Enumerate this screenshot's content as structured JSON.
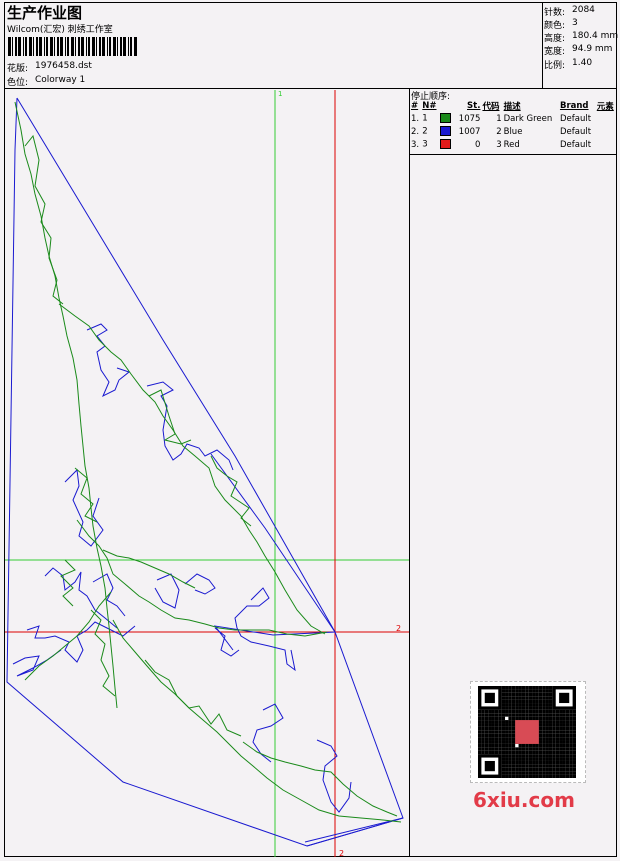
{
  "header": {
    "title": "生产作业图",
    "subtitle": "Wilcom(汇宏) 刺绣工作室",
    "design_label": "花版:",
    "design_value": "1976458.dst",
    "colorway_label": "色位:",
    "colorway_value": "Colorway 1"
  },
  "stats": [
    {
      "label": "针数:",
      "value": "2084"
    },
    {
      "label": "颜色:",
      "value": "3"
    },
    {
      "label": "高度:",
      "value": "180.4 mm"
    },
    {
      "label": "宽度:",
      "value": "94.9 mm"
    },
    {
      "label": "比例:",
      "value": "1.40"
    }
  ],
  "stop_sequence": {
    "title": "停止顺序:",
    "columns": [
      "#",
      "N#",
      "St.",
      "代码",
      "描述",
      "Brand",
      "元素"
    ],
    "rows": [
      {
        "num": "1.",
        "n": "1",
        "color": "#1a8a1a",
        "st": "1075",
        "code": "1",
        "desc": "Dark Green",
        "brand": "Default"
      },
      {
        "num": "2.",
        "n": "2",
        "color": "#1a1ad0",
        "st": "1007",
        "code": "2",
        "desc": "Blue",
        "brand": "Default"
      },
      {
        "num": "3.",
        "n": "3",
        "color": "#e01a1a",
        "st": "0",
        "code": "3",
        "desc": "Red",
        "brand": "Default"
      }
    ]
  },
  "guides": {
    "green_label": "1",
    "red_label": "2"
  },
  "watermark": {
    "text": "6xiu.com",
    "seal": "双汇图库"
  },
  "colors": {
    "green": "#1a8a1a",
    "blue": "#1a1ad0",
    "red": "#e01a1a",
    "guide_green": "#33cc33",
    "guide_red": "#dd0000"
  }
}
